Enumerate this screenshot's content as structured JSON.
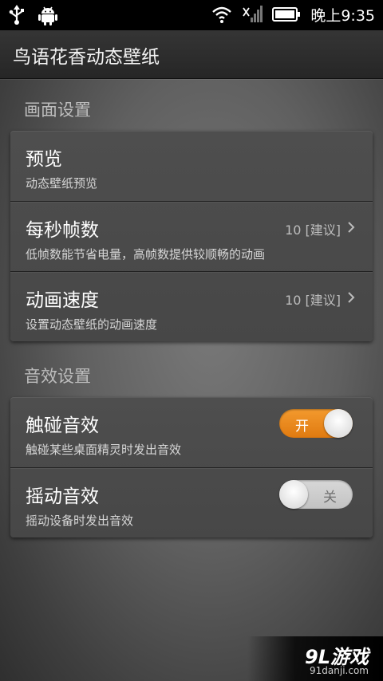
{
  "status_bar": {
    "time": "晚上9:35",
    "icons": [
      "usb-icon",
      "android-debug-icon",
      "wifi-icon",
      "no-signal-icon",
      "battery-icon"
    ]
  },
  "app": {
    "title": "鸟语花香动态壁纸"
  },
  "sections": {
    "display": {
      "header": "画面设置",
      "items": [
        {
          "title": "预览",
          "subtitle": "动态壁纸预览"
        },
        {
          "title": "每秒帧数",
          "subtitle": "低帧数能节省电量，高帧数提供较顺畅的动画",
          "value": "10 [建议]"
        },
        {
          "title": "动画速度",
          "subtitle": "设置动态壁纸的动画速度",
          "value": "10 [建议]"
        }
      ]
    },
    "sound": {
      "header": "音效设置",
      "items": [
        {
          "title": "触碰音效",
          "subtitle": "触碰某些桌面精灵时发出音效",
          "toggle_label": "开",
          "toggle_on": true
        },
        {
          "title": "摇动音效",
          "subtitle": "摇动设备时发出音效",
          "toggle_label": "关",
          "toggle_on": false
        }
      ]
    }
  },
  "watermark": {
    "logo": "9L游戏",
    "url": "91danji.com"
  },
  "colors": {
    "accent_orange": "#e8861b",
    "toggle_off": "#cfcfcf",
    "card_bg": "#4b4b4b"
  }
}
